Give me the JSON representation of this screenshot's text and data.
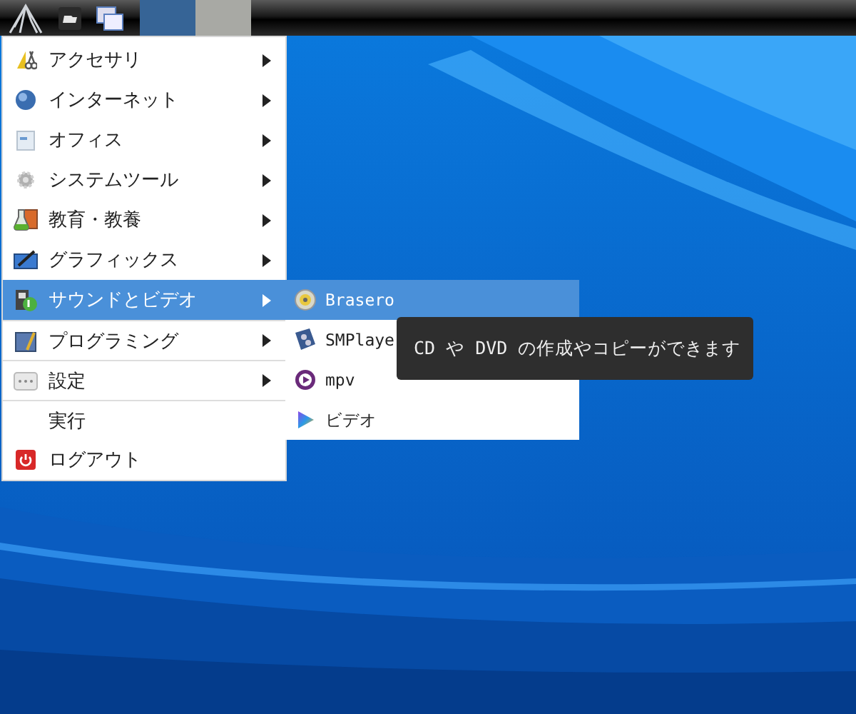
{
  "taskbar": {
    "workspaces": [
      {
        "selected": true
      },
      {
        "selected": false
      }
    ]
  },
  "menu": {
    "items": [
      {
        "label": "アクセサリ",
        "submenu": true,
        "selected": false
      },
      {
        "label": "インターネット",
        "submenu": true,
        "selected": false
      },
      {
        "label": "オフィス",
        "submenu": true,
        "selected": false
      },
      {
        "label": "システムツール",
        "submenu": true,
        "selected": false
      },
      {
        "label": "教育・教養",
        "submenu": true,
        "selected": false
      },
      {
        "label": "グラフィックス",
        "submenu": true,
        "selected": false
      },
      {
        "label": "サウンドとビデオ",
        "submenu": true,
        "selected": true
      },
      {
        "label": "プログラミング",
        "submenu": true,
        "selected": false
      },
      {
        "label": "設定",
        "submenu": true,
        "selected": false
      },
      {
        "label": "実行",
        "submenu": false,
        "selected": false
      },
      {
        "label": "ログアウト",
        "submenu": false,
        "selected": false
      }
    ]
  },
  "submenu": {
    "items": [
      {
        "label": "Brasero",
        "selected": true
      },
      {
        "label": "SMPlaye",
        "selected": false
      },
      {
        "label": "mpv",
        "selected": false
      },
      {
        "label": "ビデオ",
        "selected": false
      }
    ]
  },
  "tooltip": {
    "text": "CD や DVD の作成やコピーができます"
  }
}
